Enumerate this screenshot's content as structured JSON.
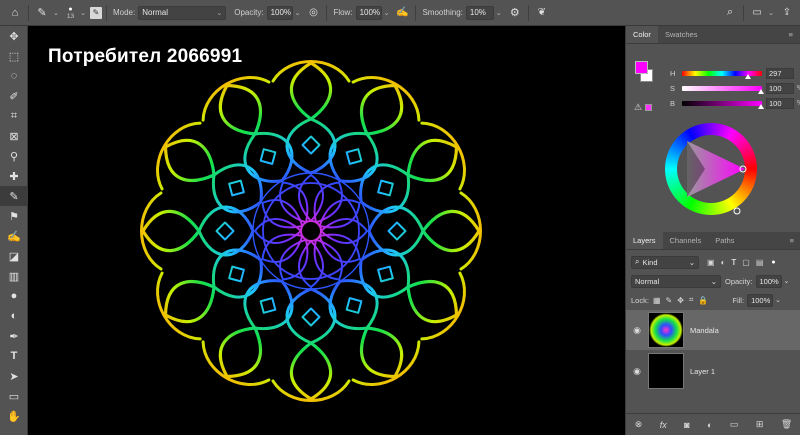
{
  "watermark": "Потребител 2066991",
  "options": {
    "brush_size": "13",
    "mode_label": "Mode:",
    "mode_value": "Normal",
    "opacity_label": "Opacity:",
    "opacity_value": "100%",
    "flow_label": "Flow:",
    "flow_value": "100%",
    "smoothing_label": "Smoothing:",
    "smoothing_value": "10%"
  },
  "color_panel": {
    "tabs": [
      "Color",
      "Swatches"
    ],
    "foreground": "#ff00ff",
    "background": "#ffffff",
    "h_label": "H",
    "h_value": "297",
    "s_label": "S",
    "s_value": "100",
    "b_label": "B",
    "b_value": "100",
    "unit": "%"
  },
  "layers_panel": {
    "tabs": [
      "Layers",
      "Channels",
      "Paths"
    ],
    "kind_label": "Kind",
    "blend_value": "Normal",
    "opacity_label": "Opacity:",
    "opacity_value": "100%",
    "lock_label": "Lock:",
    "fill_label": "Fill:",
    "fill_value": "100%",
    "layers": [
      {
        "name": "Mandala",
        "selected": true,
        "visible": true
      },
      {
        "name": "Layer 1",
        "selected": false,
        "visible": true
      }
    ]
  }
}
